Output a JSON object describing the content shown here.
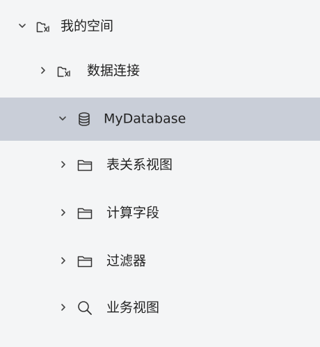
{
  "tree": {
    "items": [
      {
        "label": "我的空间",
        "icon": "workspace-icon",
        "expanded": true,
        "selected": false
      },
      {
        "label": "数据连接",
        "icon": "workspace-icon",
        "expanded": false,
        "selected": false
      },
      {
        "label": "MyDatabase",
        "icon": "database-icon",
        "expanded": true,
        "selected": true
      },
      {
        "label": "表关系视图",
        "icon": "folder-icon",
        "expanded": false,
        "selected": false
      },
      {
        "label": "计算字段",
        "icon": "folder-icon",
        "expanded": false,
        "selected": false
      },
      {
        "label": "过滤器",
        "icon": "folder-icon",
        "expanded": false,
        "selected": false
      },
      {
        "label": "业务视图",
        "icon": "search-icon",
        "expanded": false,
        "selected": false
      }
    ],
    "selected_color": "#c9ced8",
    "background_color": "#f4f5f6"
  }
}
